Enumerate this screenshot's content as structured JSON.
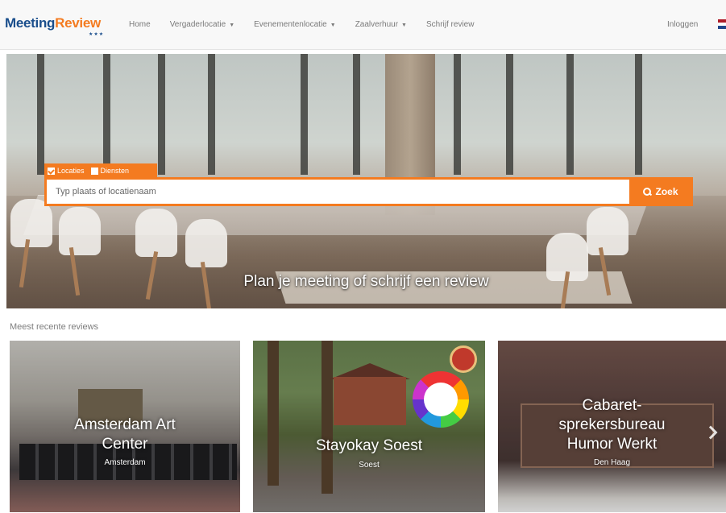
{
  "brand": {
    "logo_part1": "Meeting",
    "logo_part2": "Review",
    "logo_stars": "★★★",
    "primary_color": "#1a4e8c",
    "accent_color": "#f47b20"
  },
  "nav": {
    "items": [
      {
        "label": "Home",
        "dropdown": false
      },
      {
        "label": "Vergaderlocatie",
        "dropdown": true
      },
      {
        "label": "Evenementenlocatie",
        "dropdown": true
      },
      {
        "label": "Zaalverhuur",
        "dropdown": true
      },
      {
        "label": "Schrijf review",
        "dropdown": false
      }
    ],
    "login": "Inloggen",
    "language_flag": "nl-flag-icon"
  },
  "hero": {
    "tabs": [
      {
        "label": "Locaties",
        "checked": true
      },
      {
        "label": "Diensten",
        "checked": false
      }
    ],
    "search_placeholder": "Typ plaats of locatienaam",
    "search_button": "Zoek",
    "search_icon": "search-icon",
    "tagline": "Plan je meeting of schrijf een review"
  },
  "reviews": {
    "section_title": "Meest recente reviews",
    "cards": [
      {
        "title_line1": "Amsterdam Art",
        "title_line2": "Center",
        "city": "Amsterdam"
      },
      {
        "title_line1": "Stayokay Soest",
        "city": "Soest"
      },
      {
        "title_line1": "Cabaret-",
        "title_line2": "sprekersbureau",
        "title_line3": "Humor Werkt",
        "city": "Den Haag"
      }
    ],
    "next_icon": "chevron-right-icon"
  }
}
